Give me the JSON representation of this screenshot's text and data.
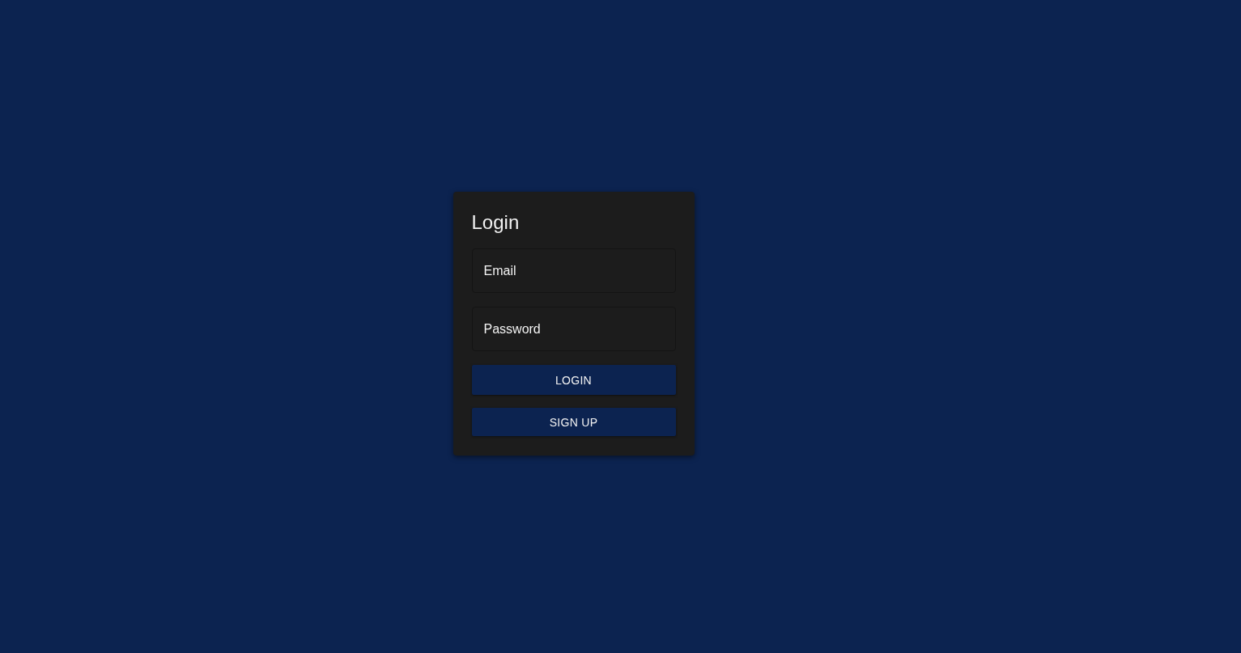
{
  "login_card": {
    "title": "Login",
    "fields": [
      {
        "placeholder": "Email"
      },
      {
        "placeholder": "Password"
      }
    ],
    "buttons": [
      "LOGIN",
      "SIGN UP"
    ]
  }
}
